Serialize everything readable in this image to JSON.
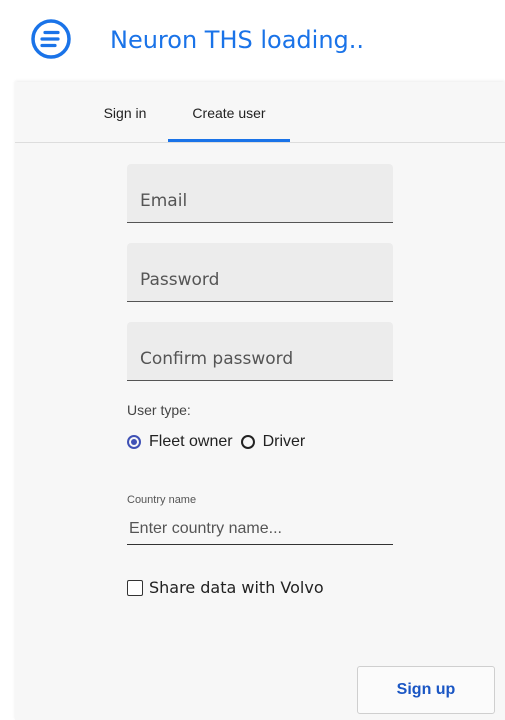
{
  "header": {
    "title": "Neuron THS loading..",
    "logo_icon": "menu-lines-icon",
    "accent_color": "#1a73e8"
  },
  "tabs": [
    {
      "label": "Sign in",
      "active": false
    },
    {
      "label": "Create user",
      "active": true
    }
  ],
  "form": {
    "email": {
      "placeholder": "Email",
      "value": ""
    },
    "password": {
      "placeholder": "Password",
      "value": ""
    },
    "confirm_password": {
      "placeholder": "Confirm password",
      "value": ""
    },
    "user_type": {
      "label": "User type:",
      "options": [
        {
          "label": "Fleet owner",
          "selected": true
        },
        {
          "label": "Driver",
          "selected": false
        }
      ]
    },
    "country": {
      "label": "Country name",
      "placeholder": "Enter country name...",
      "value": ""
    },
    "share_data": {
      "label": "Share data with Volvo",
      "checked": false
    },
    "submit_label": "Sign up"
  }
}
